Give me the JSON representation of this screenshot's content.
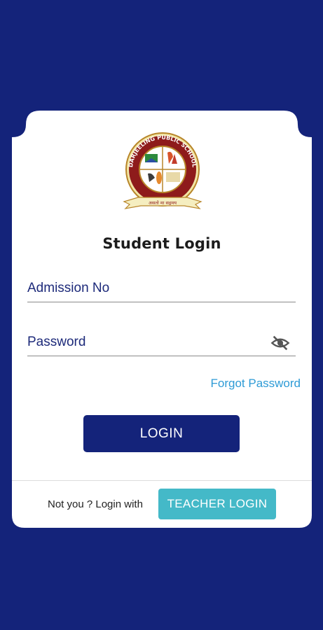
{
  "colors": {
    "background": "#14237a",
    "card": "#ffffff",
    "primary_button": "#14237a",
    "secondary_button": "#44b9c8",
    "link": "#2e9bd6",
    "field_label": "#1d2a7a"
  },
  "logo": {
    "school_name": "DARJEELING PUBLIC SCHOOL",
    "motto": "असतो मा सद्गमय"
  },
  "login": {
    "title": "Student Login",
    "admission_label": "Admission No",
    "password_label": "Password",
    "password_toggle_icon": "eye-off-icon",
    "forgot_password": "Forgot Password",
    "login_button": "LOGIN"
  },
  "footer": {
    "not_you_text": "Not you ? Login with",
    "teacher_login_button": "TEACHER LOGIN"
  }
}
